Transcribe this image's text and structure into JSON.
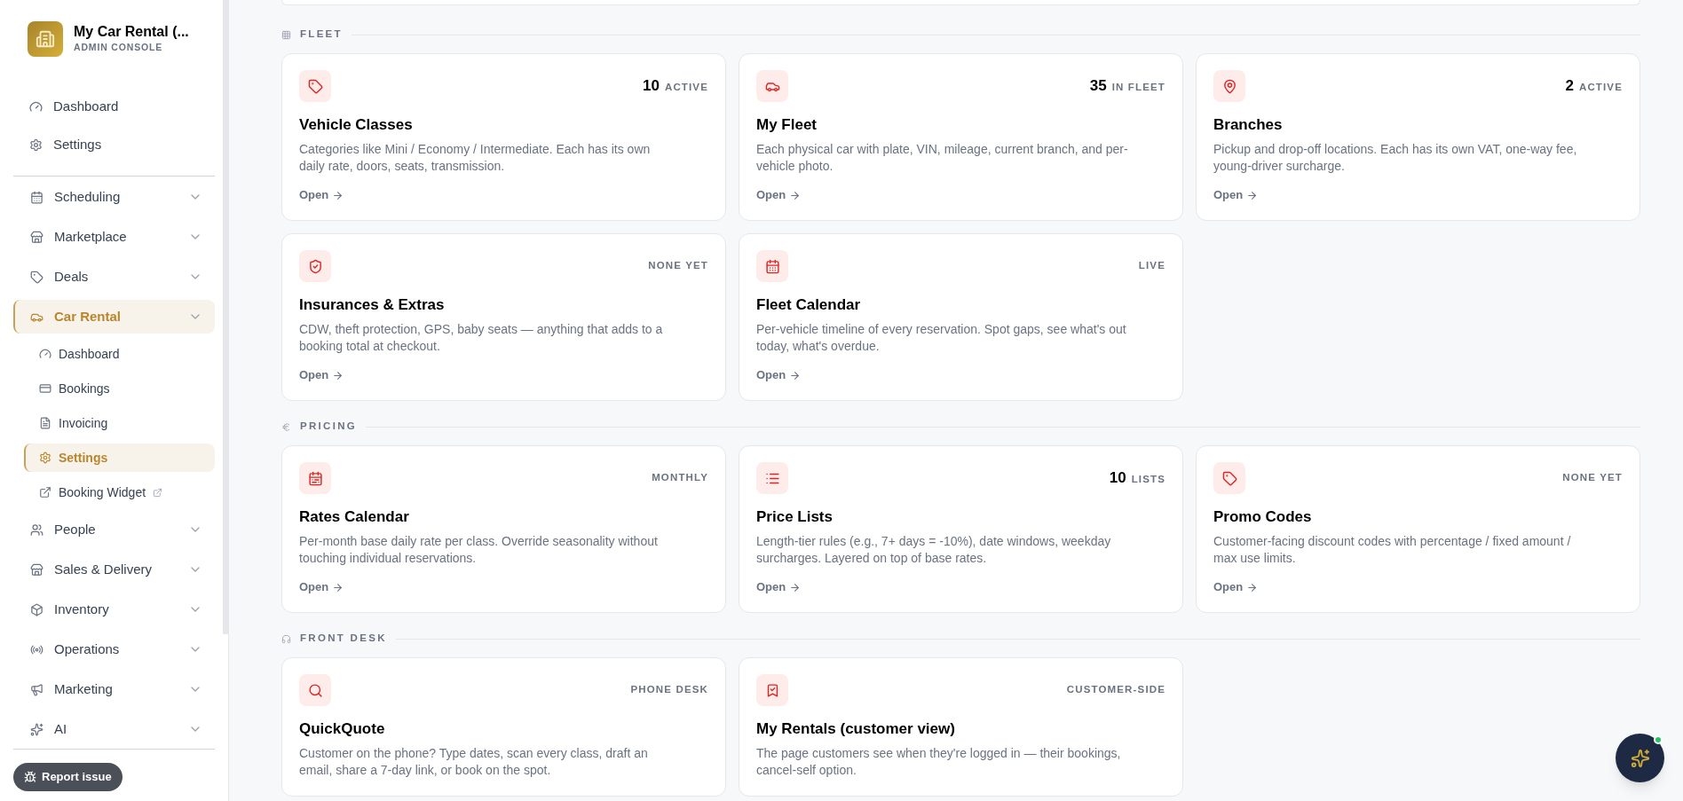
{
  "sidebar": {
    "brand": {
      "name": "My Car Rental (...",
      "subtitle": "ADMIN CONSOLE"
    },
    "top_items": [
      {
        "label": "Dashboard",
        "selected": false
      },
      {
        "label": "Settings",
        "selected": false
      }
    ],
    "groups": [
      {
        "label": "Scheduling",
        "selected": false
      },
      {
        "label": "Marketplace",
        "selected": false
      },
      {
        "label": "Deals",
        "selected": false
      },
      {
        "label": "Car Rental",
        "selected": true,
        "children": [
          {
            "label": "Dashboard",
            "selected": false,
            "kind": "link"
          },
          {
            "label": "Bookings",
            "selected": false,
            "kind": "link"
          },
          {
            "label": "Invoicing",
            "selected": false,
            "kind": "link"
          },
          {
            "label": "Settings",
            "selected": true,
            "kind": "link"
          },
          {
            "label": "Booking Widget",
            "selected": false,
            "kind": "external"
          }
        ]
      },
      {
        "label": "People",
        "selected": false
      },
      {
        "label": "Sales & Delivery",
        "selected": false
      },
      {
        "label": "Inventory",
        "selected": false
      },
      {
        "label": "Operations",
        "selected": false
      },
      {
        "label": "Marketing",
        "selected": false
      },
      {
        "label": "AI",
        "selected": false
      }
    ],
    "report_button": "Report issue"
  },
  "sections": [
    {
      "title": "FLEET",
      "cards": [
        {
          "title": "Vehicle Classes",
          "description": "Categories like Mini / Economy / Intermediate. Each has its own daily rate, doors, seats, transmission.",
          "count": "10",
          "badge": "ACTIVE",
          "link": "Open"
        },
        {
          "title": "My Fleet",
          "description": "Each physical car with plate, VIN, mileage, current branch, and per-vehicle photo.",
          "count": "35",
          "badge": "IN FLEET",
          "link": "Open"
        },
        {
          "title": "Branches",
          "description": "Pickup and drop-off locations. Each has its own VAT, one-way fee, young-driver surcharge.",
          "count": "2",
          "badge": "ACTIVE",
          "link": "Open"
        },
        {
          "title": "Insurances & Extras",
          "description": "CDW, theft protection, GPS, baby seats — anything that adds to a booking total at checkout.",
          "badge": "NONE YET",
          "link": "Open"
        },
        {
          "title": "Fleet Calendar",
          "description": "Per-vehicle timeline of every reservation. Spot gaps, see what's out today, what's overdue.",
          "badge": "LIVE",
          "link": "Open"
        }
      ]
    },
    {
      "title": "PRICING",
      "cards": [
        {
          "title": "Rates Calendar",
          "description": "Per-month base daily rate per class. Override seasonality without touching individual reservations.",
          "badge": "MONTHLY",
          "link": "Open"
        },
        {
          "title": "Price Lists",
          "description": "Length-tier rules (e.g., 7+ days = -10%), date windows, weekday surcharges. Layered on top of base rates.",
          "count": "10",
          "badge": "LISTS",
          "link": "Open"
        },
        {
          "title": "Promo Codes",
          "description": "Customer-facing discount codes with percentage / fixed amount / max use limits.",
          "badge": "NONE YET",
          "link": "Open"
        }
      ]
    },
    {
      "title": "FRONT DESK",
      "cards": [
        {
          "title": "QuickQuote",
          "description": "Customer on the phone? Type dates, scan every class, draft an email, share a 7-day link, or book on the spot.",
          "badge": "PHONE DESK"
        },
        {
          "title": "My Rentals (customer view)",
          "description": "The page customers see when they're logged in — their bookings, cancel-self option.",
          "badge": "CUSTOMER-SIDE"
        }
      ]
    }
  ]
}
